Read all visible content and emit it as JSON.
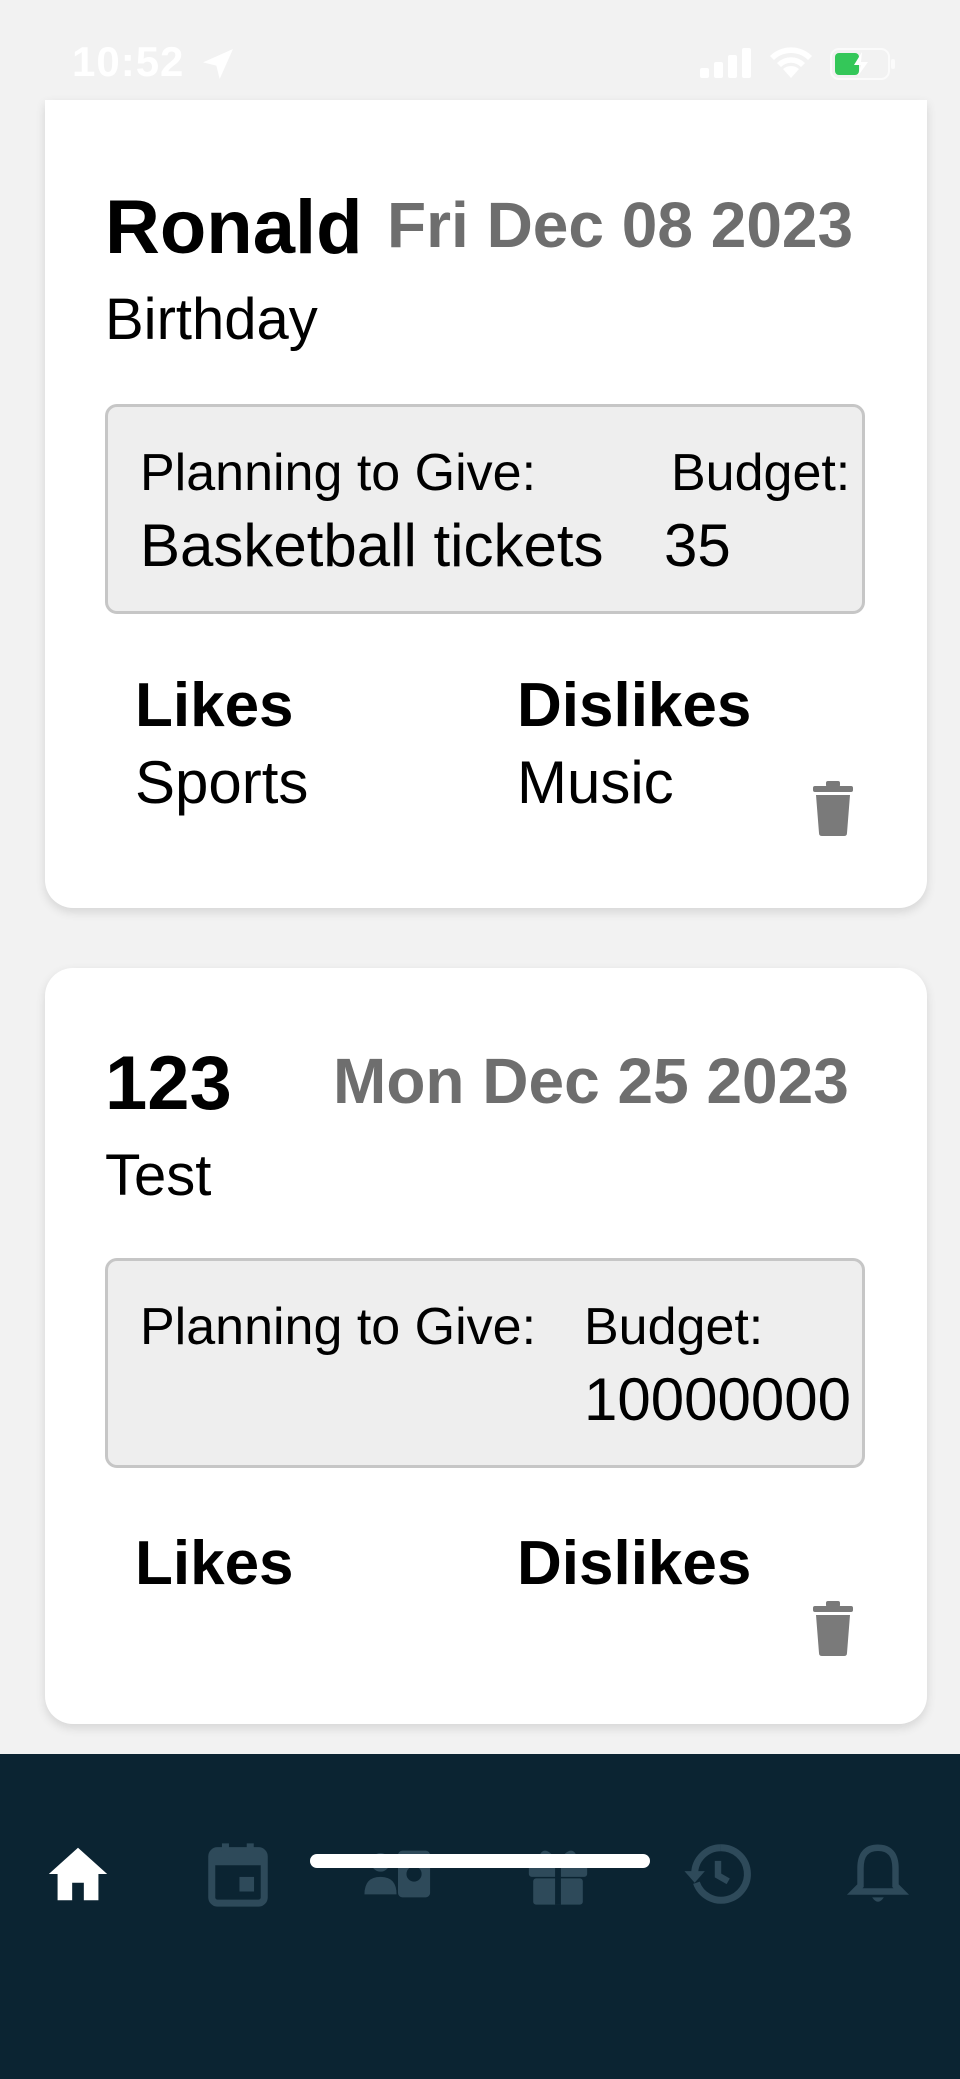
{
  "status_bar": {
    "time": "10:52"
  },
  "cards": [
    {
      "name": "Ronald",
      "date": "Fri Dec 08 2023",
      "occasion": "Birthday",
      "planning_label": "Planning to Give:",
      "planning_value": "Basketball tickets",
      "budget_label": "Budget:",
      "budget_value": "35",
      "likes_label": "Likes",
      "likes_value": "Sports",
      "dislikes_label": "Dislikes",
      "dislikes_value": "Music"
    },
    {
      "name": "123",
      "date": "Mon Dec 25 2023",
      "occasion": "Test",
      "planning_label": "Planning to Give:",
      "planning_value": "",
      "budget_label": "Budget:",
      "budget_value": "10000000",
      "likes_label": "Likes",
      "likes_value": "",
      "dislikes_label": "Dislikes",
      "dislikes_value": ""
    }
  ],
  "tab_bar": {
    "tabs": [
      {
        "icon": "home-icon",
        "active": true
      },
      {
        "icon": "calendar-icon",
        "active": false
      },
      {
        "icon": "contact-card-icon",
        "active": false
      },
      {
        "icon": "gift-icon",
        "active": false
      },
      {
        "icon": "history-icon",
        "active": false
      },
      {
        "icon": "bell-icon",
        "active": false
      }
    ],
    "active_color": "#ffffff",
    "inactive_color": "#2e4a5a"
  }
}
